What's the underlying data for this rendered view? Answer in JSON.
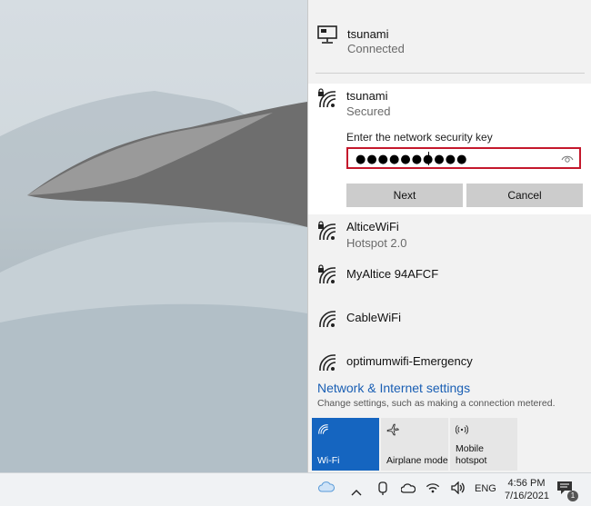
{
  "connected": {
    "name": "tsunami",
    "status": "Connected",
    "icon": "ethernet-monitor-icon"
  },
  "selected_network": {
    "name": "tsunami",
    "status": "Secured",
    "key_label": "Enter the network security key",
    "key_value": "●●●●●●●●●●",
    "next_label": "Next",
    "cancel_label": "Cancel"
  },
  "networks": [
    {
      "name": "AlticeWiFi",
      "sub": "Hotspot 2.0",
      "secured": true
    },
    {
      "name": "MyAltice 94AFCF",
      "sub": "",
      "secured": true
    },
    {
      "name": "CableWiFi",
      "sub": "",
      "secured": false
    },
    {
      "name": "optimumwifi-Emergency",
      "sub": "",
      "secured": false
    }
  ],
  "settings": {
    "title": "Network & Internet settings",
    "description": "Change settings, such as making a connection metered."
  },
  "quick_actions": [
    {
      "label": "Wi-Fi",
      "icon": "wifi-icon",
      "active": true
    },
    {
      "label": "Airplane mode",
      "icon": "airplane-icon",
      "active": false
    },
    {
      "label": "Mobile hotspot",
      "label_line1": "Mobile",
      "label_line2": "hotspot",
      "icon": "mobile-hotspot-icon",
      "active": false
    }
  ],
  "taskbar": {
    "language": "ENG",
    "time": "4:56 PM",
    "date": "7/16/2021",
    "notification_count": "1"
  },
  "colors": {
    "accent": "#1565c0",
    "link": "#1a5fb4",
    "input_border": "#c4182c"
  }
}
